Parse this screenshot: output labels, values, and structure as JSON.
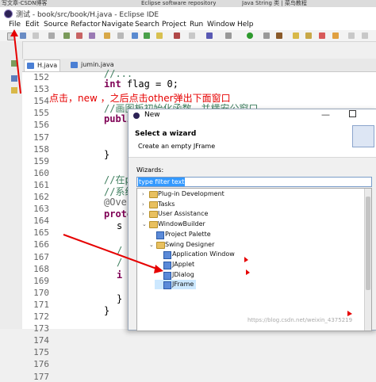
{
  "browser_tabs": [
    {
      "label": "写文章-CSDN博客"
    },
    {
      "label": "Eclipse software repository"
    },
    {
      "label": "Java String 类 | 菜鸟教程"
    }
  ],
  "window": {
    "title": "测试 - book/src/book/H.java - Eclipse IDE"
  },
  "menu": [
    "File",
    "Edit",
    "Source",
    "Refactor",
    "Navigate",
    "Search",
    "Project",
    "Run",
    "Window",
    "Help"
  ],
  "editor_tabs": [
    {
      "label": "H.java",
      "active": true
    },
    {
      "label": "jumin.java",
      "active": false
    }
  ],
  "line_numbers": [
    "152",
    "153",
    "154",
    "155",
    "156",
    "157",
    "158",
    "159",
    "160",
    "161",
    "162",
    "163",
    "164",
    "165",
    "166",
    "167",
    "168",
    "169",
    "170",
    "171",
    "172",
    "173",
    "174",
    "175",
    "176",
    "177"
  ],
  "code_lines": {
    "l152": "//...",
    "l153_kw": "int",
    "l153_rest": " flag = 0;",
    "l155": "//画图板初始化函数，并横安公窗口",
    "l156": "publi",
    "l158": "}",
    "l160": "//在p",
    "l161": "//系统",
    "l162": "@Over",
    "l163": "prote",
    "l164": "s",
    "l166": "/",
    "l167": "/",
    "l168": "i",
    "l170": "}",
    "l171": "}"
  },
  "annotation": "点击，new ，之后点击other弹出下面窗口",
  "dialog": {
    "title": "New",
    "heading": "Select a wizard",
    "description": "Create an empty JFrame",
    "wizards_label": "Wizards:",
    "filter_value": "type filter text",
    "tree": [
      {
        "label": "Plug-in Development",
        "level": 1,
        "state": "collapsed",
        "kind": "folder"
      },
      {
        "label": "Tasks",
        "level": 1,
        "state": "collapsed",
        "kind": "folder"
      },
      {
        "label": "User Assistance",
        "level": 1,
        "state": "collapsed",
        "kind": "folder"
      },
      {
        "label": "WindowBuilder",
        "level": 1,
        "state": "expanded",
        "kind": "folder"
      },
      {
        "label": "Project Palette",
        "level": 2,
        "state": "leaf",
        "kind": "wizard"
      },
      {
        "label": "Swing Designer",
        "level": 2,
        "state": "expanded",
        "kind": "folder"
      },
      {
        "label": "Application Window",
        "level": 3,
        "state": "leaf",
        "kind": "wizard"
      },
      {
        "label": "JApplet",
        "level": 3,
        "state": "leaf",
        "kind": "wizard"
      },
      {
        "label": "JDialog",
        "level": 3,
        "state": "leaf",
        "kind": "wizard"
      },
      {
        "label": "JFrame",
        "level": 3,
        "state": "selected",
        "kind": "wizard"
      }
    ]
  },
  "watermark": "https://blog.csdn.net/weixin_4375219",
  "colors": {
    "keyword": "#7f0055",
    "comment": "#3f7f5f",
    "annotation_red": "#e60000",
    "selection": "#cce8ff"
  }
}
